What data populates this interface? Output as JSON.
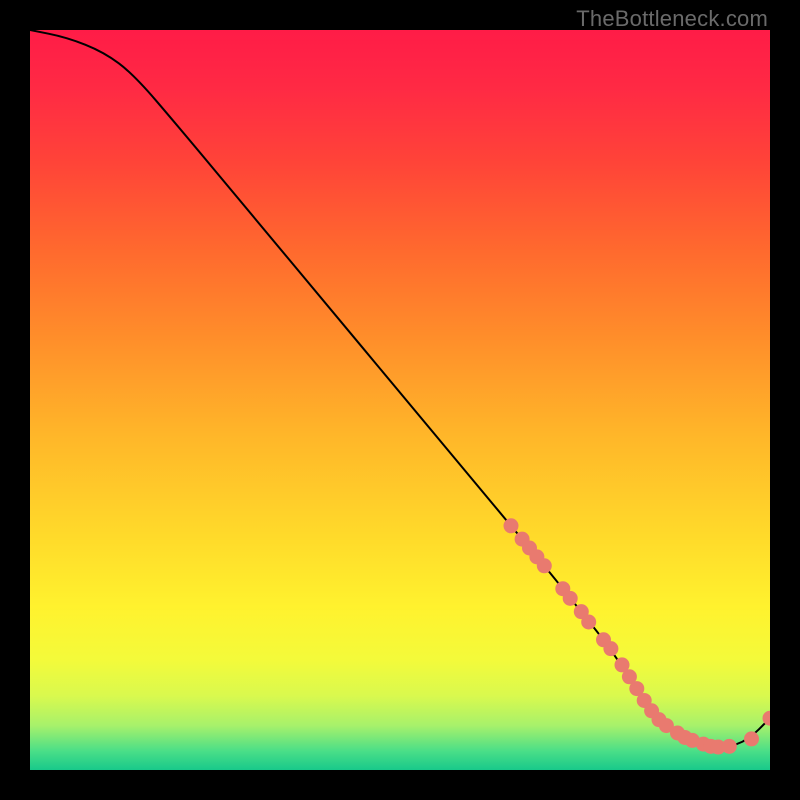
{
  "watermark": "TheBottleneck.com",
  "colors": {
    "background": "#000000",
    "gradient_stops": [
      {
        "offset": 0.0,
        "color": "#ff1c47"
      },
      {
        "offset": 0.08,
        "color": "#ff2a44"
      },
      {
        "offset": 0.18,
        "color": "#ff4438"
      },
      {
        "offset": 0.3,
        "color": "#ff6a2e"
      },
      {
        "offset": 0.42,
        "color": "#ff8f2a"
      },
      {
        "offset": 0.55,
        "color": "#ffb729"
      },
      {
        "offset": 0.68,
        "color": "#ffd92a"
      },
      {
        "offset": 0.78,
        "color": "#fff22e"
      },
      {
        "offset": 0.85,
        "color": "#f4fa3a"
      },
      {
        "offset": 0.9,
        "color": "#d9f94e"
      },
      {
        "offset": 0.94,
        "color": "#a7f16b"
      },
      {
        "offset": 0.975,
        "color": "#49de88"
      },
      {
        "offset": 1.0,
        "color": "#18c98a"
      }
    ],
    "curve": "#000000",
    "marker_fill": "#e97a6f",
    "marker_stroke": "#c55c54"
  },
  "chart_data": {
    "type": "line",
    "title": "",
    "xlabel": "",
    "ylabel": "",
    "xlim": [
      0,
      100
    ],
    "ylim": [
      0,
      100
    ],
    "grid": false,
    "legend": false,
    "series": [
      {
        "name": "curve",
        "x": [
          0,
          5,
          10,
          14,
          20,
          30,
          40,
          50,
          60,
          65,
          70,
          74,
          78,
          82,
          84,
          86,
          90,
          94,
          97,
          100
        ],
        "y": [
          100,
          99,
          97,
          94,
          87,
          75,
          63,
          51,
          39,
          33,
          27,
          22,
          17,
          11,
          8,
          6,
          4,
          3,
          4,
          7
        ]
      }
    ],
    "markers": [
      {
        "x": 65.0,
        "y": 33.0
      },
      {
        "x": 66.5,
        "y": 31.2
      },
      {
        "x": 67.5,
        "y": 30.0
      },
      {
        "x": 68.5,
        "y": 28.8
      },
      {
        "x": 69.5,
        "y": 27.6
      },
      {
        "x": 72.0,
        "y": 24.5
      },
      {
        "x": 73.0,
        "y": 23.2
      },
      {
        "x": 74.5,
        "y": 21.4
      },
      {
        "x": 75.5,
        "y": 20.0
      },
      {
        "x": 77.5,
        "y": 17.6
      },
      {
        "x": 78.5,
        "y": 16.4
      },
      {
        "x": 80.0,
        "y": 14.2
      },
      {
        "x": 81.0,
        "y": 12.6
      },
      {
        "x": 82.0,
        "y": 11.0
      },
      {
        "x": 83.0,
        "y": 9.4
      },
      {
        "x": 84.0,
        "y": 8.0
      },
      {
        "x": 85.0,
        "y": 6.8
      },
      {
        "x": 86.0,
        "y": 6.0
      },
      {
        "x": 87.5,
        "y": 5.0
      },
      {
        "x": 88.5,
        "y": 4.4
      },
      {
        "x": 89.5,
        "y": 4.0
      },
      {
        "x": 91.0,
        "y": 3.5
      },
      {
        "x": 92.0,
        "y": 3.2
      },
      {
        "x": 93.0,
        "y": 3.1
      },
      {
        "x": 94.5,
        "y": 3.2
      },
      {
        "x": 97.5,
        "y": 4.2
      },
      {
        "x": 100.0,
        "y": 7.0
      }
    ]
  }
}
